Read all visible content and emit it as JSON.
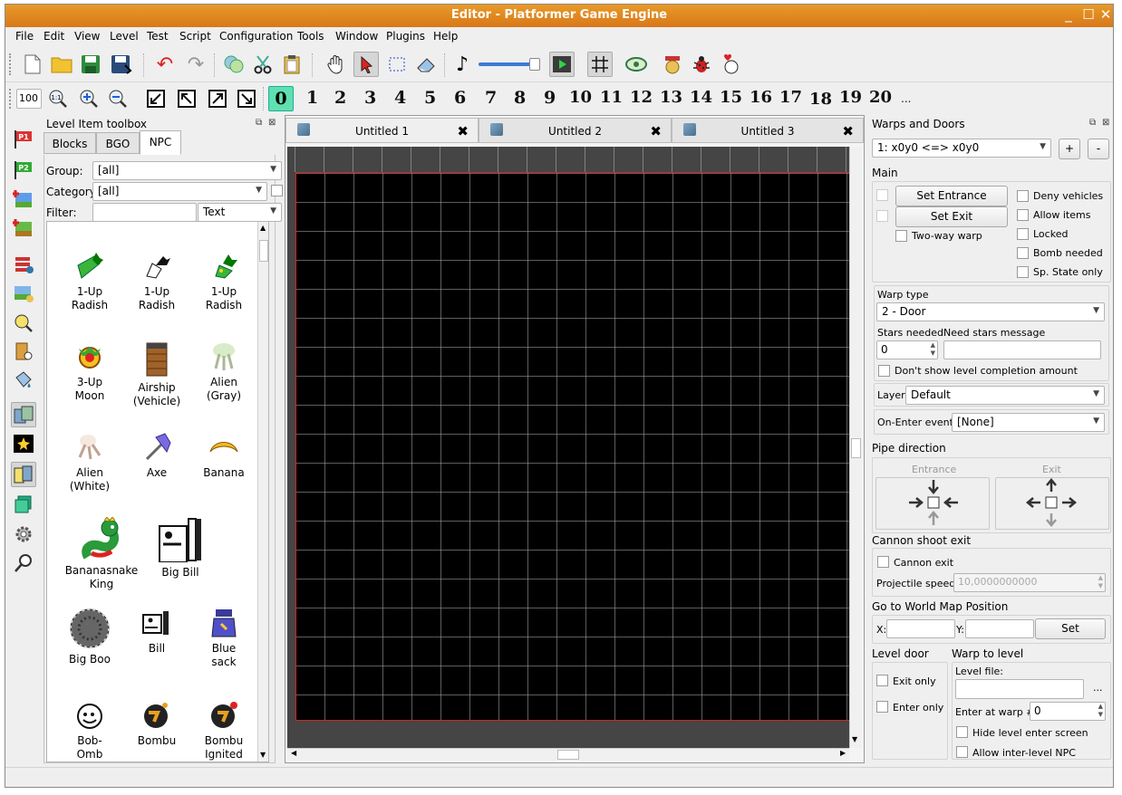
{
  "window": {
    "title": "Editor - Platformer Game Engine"
  },
  "menu": [
    "File",
    "Edit",
    "View",
    "Level",
    "Test",
    "Script",
    "Configuration",
    "Tools",
    "Window",
    "Plugins",
    "Help"
  ],
  "toolbar2": {
    "zoom_value": "100",
    "zoom_reset_label": "1:1",
    "layers": [
      "0",
      "1",
      "2",
      "3",
      "4",
      "5",
      "6",
      "7",
      "8",
      "9",
      "10",
      "11",
      "12",
      "13",
      "14",
      "15",
      "16",
      "17",
      "18",
      "19",
      "20"
    ],
    "more": "..."
  },
  "toolbox": {
    "title": "Level Item toolbox",
    "tabs": [
      "Blocks",
      "BGO",
      "NPC"
    ],
    "selected_tab": "NPC",
    "group_label": "Group:",
    "group_value": "[all]",
    "category_label": "Category:",
    "category_value": "[all]",
    "filter_label": "Filter:",
    "filter_value": "",
    "filter_mode": "Text",
    "items": [
      {
        "l1": "1-Up",
        "l2": "Radish",
        "icon": "radish-icon"
      },
      {
        "l1": "1-Up",
        "l2": "Radish",
        "icon": "radish-icon"
      },
      {
        "l1": "1-Up",
        "l2": "Radish",
        "icon": "radish-icon"
      },
      {
        "l1": "3-Up",
        "l2": "Moon",
        "icon": "moon-icon"
      },
      {
        "l1": "Airship",
        "l2": "(Vehicle)",
        "icon": "airship-icon"
      },
      {
        "l1": "Alien",
        "l2": "(Gray)",
        "icon": "alien-gray-icon"
      },
      {
        "l1": "Alien",
        "l2": "(White)",
        "icon": "alien-white-icon"
      },
      {
        "l1": "Axe",
        "l2": "",
        "icon": "axe-icon"
      },
      {
        "l1": "Banana",
        "l2": "",
        "icon": "banana-icon"
      },
      {
        "l1": "Bananasnake",
        "l2": "King",
        "icon": "snake-icon"
      },
      {
        "l1": "Big Bill",
        "l2": "",
        "icon": "big-bill-icon"
      },
      {
        "l1": "Big Boo",
        "l2": "",
        "icon": "big-boo-icon"
      },
      {
        "l1": "Bill",
        "l2": "",
        "icon": "bill-icon"
      },
      {
        "l1": "Blue",
        "l2": "sack",
        "icon": "sack-icon"
      },
      {
        "l1": "Bob-",
        "l2": "Omb",
        "icon": "bob-omb-icon"
      },
      {
        "l1": "Bombu",
        "l2": "",
        "icon": "bombu-icon"
      },
      {
        "l1": "Bombu",
        "l2": "Ignited",
        "icon": "bombu-ignited-icon"
      }
    ]
  },
  "documents": [
    "Untitled 1",
    "Untitled 2",
    "Untitled 3"
  ],
  "warps": {
    "title": "Warps and Doors",
    "current": "1: x0y0 <=> x0y0",
    "add_label": "+",
    "remove_label": "-",
    "main_label": "Main",
    "set_entrance": "Set Entrance",
    "set_exit": "Set Exit",
    "two_way": "Two-way warp",
    "flags": [
      "Deny vehicles",
      "Allow items",
      "Locked",
      "Bomb needed",
      "Sp. State only"
    ],
    "warp_type_label": "Warp type",
    "warp_type": "2 - Door",
    "stars_needed_label": "Stars needed",
    "stars_needed": "0",
    "need_stars_msg_label": "Need stars message",
    "dont_show": "Don't show level completion amount",
    "layer_label": "Layer:",
    "layer": "Default",
    "on_enter_label": "On-Enter event:",
    "on_enter": "[None]",
    "pipe_direction": "Pipe direction",
    "entrance": "Entrance",
    "exit": "Exit",
    "cannon_title": "Cannon shoot exit",
    "cannon_exit": "Cannon exit",
    "projectile_label": "Projectile speed:",
    "projectile": "10,0000000000",
    "world_map_title": "Go to World Map Position",
    "x_label": "X:",
    "y_label": "Y:",
    "set_label": "Set",
    "level_door": "Level door",
    "exit_only": "Exit only",
    "enter_only": "Enter only",
    "warp_to_level": "Warp to level",
    "level_file_label": "Level file:",
    "browse": "...",
    "enter_warp_label": "Enter at warp #",
    "enter_warp": "0",
    "hide_enter": "Hide level enter screen",
    "allow_npc": "Allow inter-level NPC"
  },
  "colors": {
    "title_bar": "#e08a22",
    "level_border": "#d82020",
    "level_bg": "#000000",
    "canvas_bg": "#454545"
  }
}
